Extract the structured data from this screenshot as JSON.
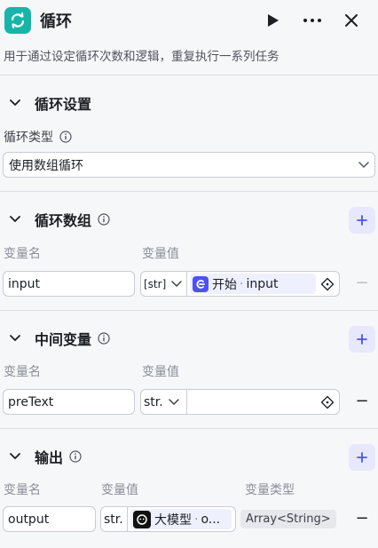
{
  "header": {
    "title": "循环",
    "description": "用于通过设定循环次数和逻辑，重复执行一系列任务"
  },
  "loop_settings": {
    "section_title": "循环设置",
    "type_label": "循环类型",
    "type_value": "使用数组循环"
  },
  "loop_array": {
    "section_title": "循环数组",
    "name_label": "变量名",
    "value_label": "变量值",
    "row": {
      "name": "input",
      "type": "[str]",
      "ref_node": "开始",
      "ref_sep": "·",
      "ref_var": "input"
    }
  },
  "intermediate": {
    "section_title": "中间变量",
    "name_label": "变量名",
    "value_label": "变量值",
    "row": {
      "name": "preText",
      "type": "str."
    }
  },
  "output": {
    "section_title": "输出",
    "name_label": "变量名",
    "value_label": "变量值",
    "type_label": "变量类型",
    "row": {
      "name": "output",
      "type": "str.",
      "ref_node": "大模型",
      "ref_sep": "·",
      "ref_var": "o...",
      "var_type": "Array<String>"
    }
  },
  "colors": {
    "accent": "#4d53e8",
    "loop_icon_bg": "#17b5a9",
    "plus_bg": "#e7e8fb"
  }
}
